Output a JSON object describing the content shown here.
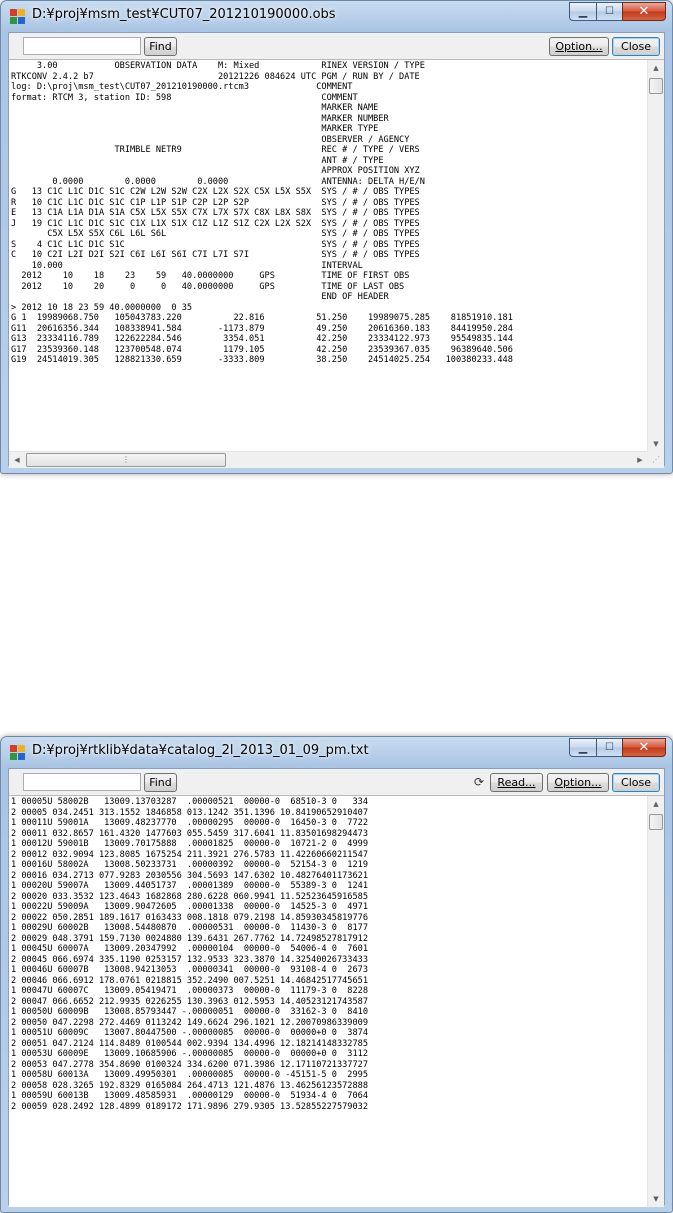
{
  "window1": {
    "title": "D:¥proj¥msm_test¥CUT07_201210190000.obs",
    "find_button": "Find",
    "option_button": "Option...",
    "close_button": "Close",
    "find_value": "",
    "lines": [
      "     3.00           OBSERVATION DATA    M: Mixed            RINEX VERSION / TYPE",
      "RTKCONV 2.4.2 b7                        20121226 084624 UTC PGM / RUN BY / DATE",
      "log: D:\\proj\\msm_test\\CUT07_201210190000.rtcm3             COMMENT",
      "format: RTCM 3, station ID: 598                             COMMENT",
      "                                                            MARKER NAME",
      "                                                            MARKER NUMBER",
      "                                                            MARKER TYPE",
      "                                                            OBSERVER / AGENCY",
      "                    TRIMBLE NETR9                           REC # / TYPE / VERS",
      "                                                            ANT # / TYPE",
      "                                                            APPROX POSITION XYZ",
      "        0.0000        0.0000        0.0000                  ANTENNA: DELTA H/E/N",
      "G   13 C1C L1C D1C S1C C2W L2W S2W C2X L2X S2X C5X L5X S5X  SYS / # / OBS TYPES",
      "R   10 C1C L1C D1C S1C C1P L1P S1P C2P L2P S2P              SYS / # / OBS TYPES",
      "E   13 C1A L1A D1A S1A C5X L5X S5X C7X L7X S7X C8X L8X S8X  SYS / # / OBS TYPES",
      "J   19 C1C L1C D1C S1C C1X L1X S1X C1Z L1Z S1Z C2X L2X S2X  SYS / # / OBS TYPES",
      "       C5X L5X S5X C6L L6L S6L                              SYS / # / OBS TYPES",
      "S    4 C1C L1C D1C S1C                                      SYS / # / OBS TYPES",
      "C   10 C2I L2I D2I S2I C6I L6I S6I C7I L7I S7I              SYS / # / OBS TYPES",
      "    10.000                                                  INTERVAL",
      "  2012    10    18    23    59   40.0000000     GPS         TIME OF FIRST OBS",
      "  2012    10    20     0     0   40.0000000     GPS         TIME OF LAST OBS",
      "                                                            END OF HEADER",
      "> 2012 10 18 23 59 40.0000000  0 35",
      "G 1  19989068.750   105043783.220          22.816          51.250    19989075.285    81851910.181",
      "G11  20616356.344   108338941.584       -1173.879          49.250    20616360.183    84419950.284",
      "G13  23334116.789   122622284.546        3354.051          42.250    23334122.973    95549835.144",
      "G17  23539360.148   123700548.074        1179.105          42.250    23539367.035    96389640.506",
      "G19  24514019.305   128821330.659       -3333.809          38.250    24514025.254   100380233.448"
    ]
  },
  "window2": {
    "title": "D:¥proj¥rtklib¥data¥catalog_2l_2013_01_09_pm.txt",
    "find_button": "Find",
    "read_button": "Read...",
    "option_button": "Option...",
    "close_button": "Close",
    "find_value": "",
    "lines": [
      "1 00005U 58002B   13009.13703287  .00000521  00000-0  68510-3 0   334",
      "2 00005 034.2451 313.1552 1846858 013.1242 351.1396 10.84190652910407",
      "1 00011U 59001A   13009.48237770  .00000295  00000-0  16450-3 0  7722",
      "2 00011 032.8657 161.4320 1477603 055.5459 317.6041 11.83501698294473",
      "1 00012U 59001B   13009.70175888  .00001825  00000-0  10721-2 0  4999",
      "2 00012 032.9094 123.8085 1675254 211.3921 276.5783 11.42260660211547",
      "1 00016U 58002A   13008.50233731  .00000392  00000-0  52154-3 0  1219",
      "2 00016 034.2713 077.9283 2030556 304.5693 147.6302 10.48276401173621",
      "1 00020U 59007A   13009.44051737  .00001389  00000-0  55389-3 0  1241",
      "2 00020 033.3532 123.4643 1682868 280.6228 060.9941 11.52523645916585",
      "1 00022U 59009A   13009.90472605  .00001338  00000-0  14525-3 0  4971",
      "2 00022 050.2851 189.1617 0163433 008.1818 079.2198 14.85930345819776",
      "1 00029U 60002B   13008.54480870  .00000531  00000-0  11430-3 0  8177",
      "2 00029 048.3791 159.7130 0024880 139.6431 267.7762 14.72498527817912",
      "1 00045U 60007A   13009.20347992  .00000104  00000-0  54006-4 0  7601",
      "2 00045 066.6974 335.1190 0253157 132.9533 323.3870 14.32540026733433",
      "1 00046U 60007B   13008.94213053  .00000341  00000-0  93108-4 0  2673",
      "2 00046 066.6912 178.0761 0218815 352.2490 007.5251 14.46842517745651",
      "1 00047U 60007C   13009.05419471  .00000373  00000-0  11179-3 0  8228",
      "2 00047 066.6652 212.9935 0226255 130.3963 012.5953 14.40523121743587",
      "1 00050U 60009B   13008.85793447 -.00000051  00000-0  33162-3 0  8410",
      "2 00050 047.2298 272.4469 0113242 149.6624 296.1021 12.20070986339009",
      "1 00051U 60009C   13007.80447500 -.00000085  00000-0  00000+0 0  3874",
      "2 00051 047.2124 114.8489 0100544 002.9394 134.4996 12.18214148332785",
      "1 00053U 60009E   13009.10685906 -.00000085  00000-0  00000+0 0  3112",
      "2 00053 047.2778 354.8690 0100324 334.6200 071.3986 12.17110721337727",
      "1 00058U 60013A   13009.49950301  .00000085  00000-0 -45151-5 0  2995",
      "2 00058 028.3265 192.8329 0165084 264.4713 121.4876 13.46256123572888",
      "1 00059U 60013B   13009.48585931  .00000129  00000-0  51934-4 0  7064",
      "2 00059 028.2492 128.4899 0189172 171.9896 279.9305 13.52855227579032"
    ]
  },
  "colors": {
    "close_button": "#c23c1e",
    "titlebar": "#a9c4e4",
    "default_button_border": "#3c7fb1"
  },
  "icons": {
    "app": "rtklib-app-icon",
    "minimize": "minimize-icon",
    "maximize": "maximize-icon",
    "close": "close-icon",
    "refresh": "refresh-icon"
  }
}
